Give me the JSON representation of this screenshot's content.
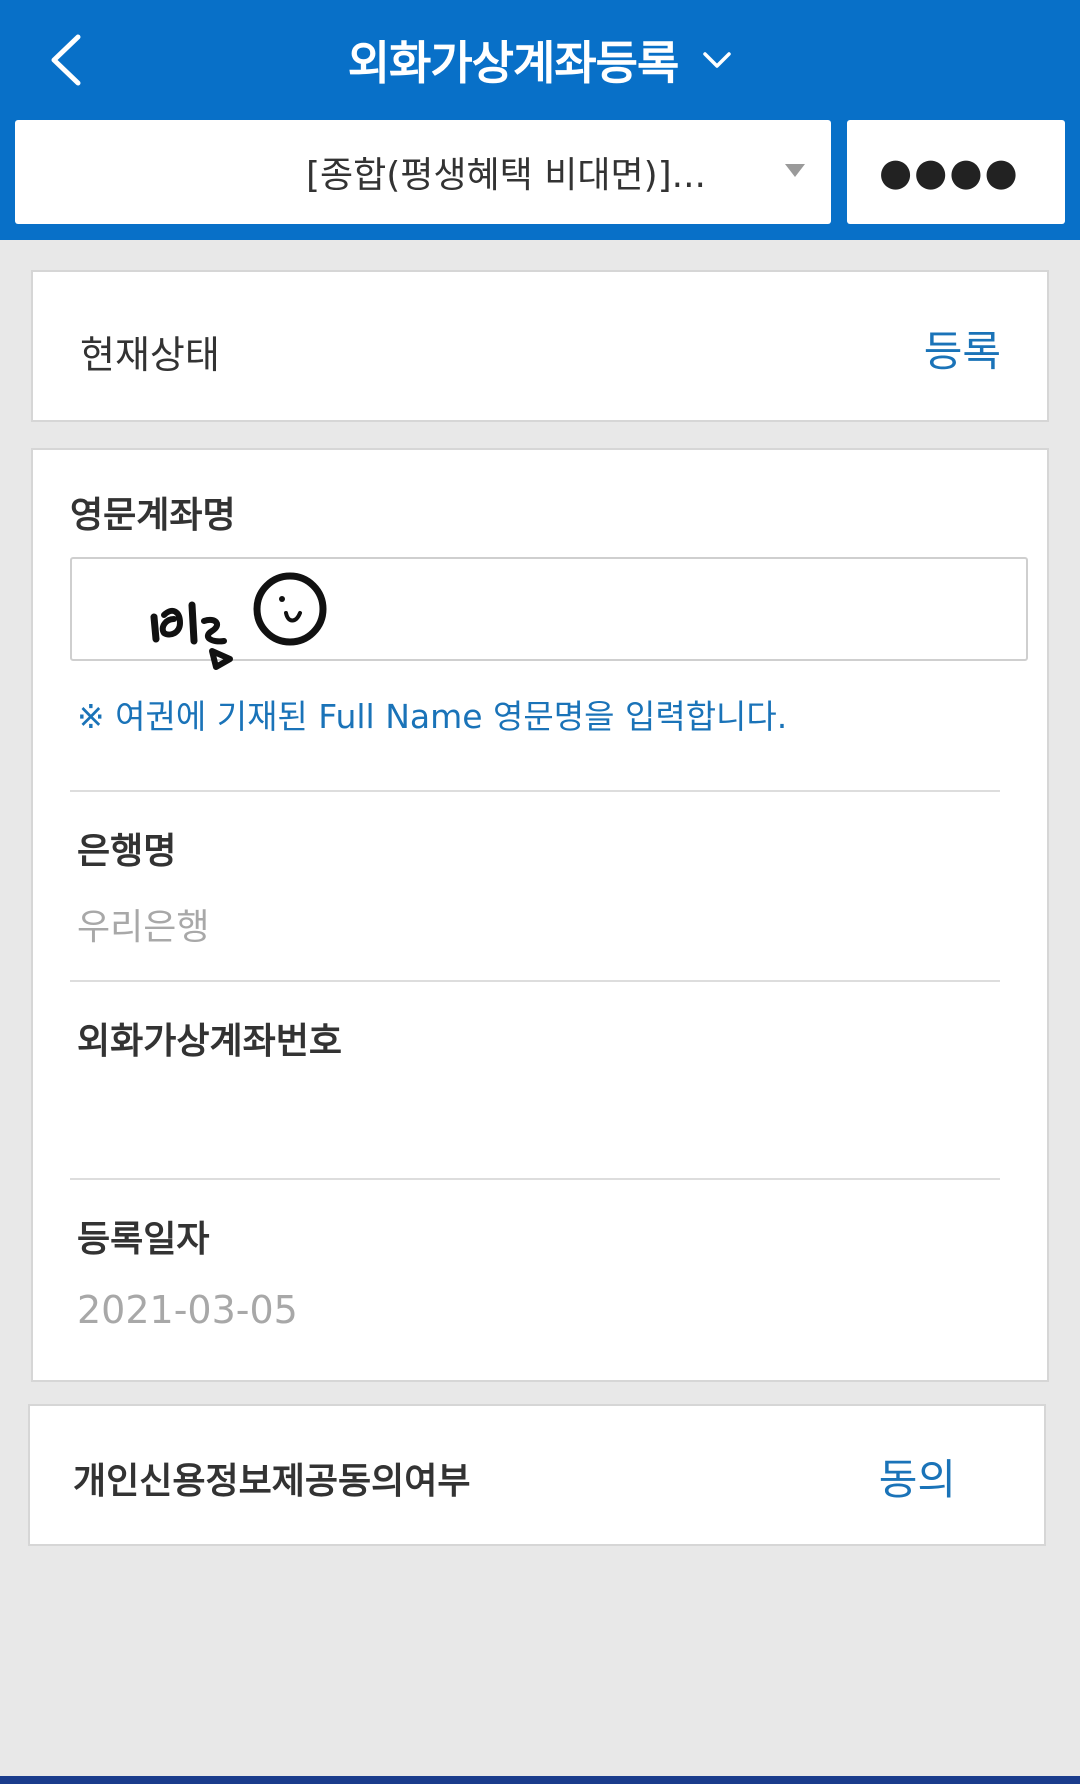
{
  "header": {
    "title": "외화가상계좌등록",
    "account_selector": "[종합(평생혜택 비대면)]...",
    "pin_mask": "●●●●"
  },
  "status_card": {
    "label": "현재상태",
    "value": "등록"
  },
  "detail_card": {
    "english_account_name": {
      "label": "영문계좌명",
      "input_value": "",
      "notice": "※ 여권에 기재된 Full Name 영문명을 입력합니다."
    },
    "bank_name": {
      "label": "은행명",
      "value": "우리은행"
    },
    "virtual_account_number": {
      "label": "외화가상계좌번호",
      "value": ""
    },
    "registration_date": {
      "label": "등록일자",
      "value": "2021-03-05"
    }
  },
  "consent_card": {
    "label": "개인신용정보제공동의여부",
    "value": "동의"
  },
  "colors": {
    "header_bg": "#0870c8",
    "accent_text": "#1a73b8",
    "page_bg": "#e8e8e8"
  },
  "icons": {
    "back": "chevron-left-icon",
    "title_menu": "chevron-down-icon",
    "select_arrow": "caret-down-icon",
    "signature": "handwritten-scribble"
  }
}
